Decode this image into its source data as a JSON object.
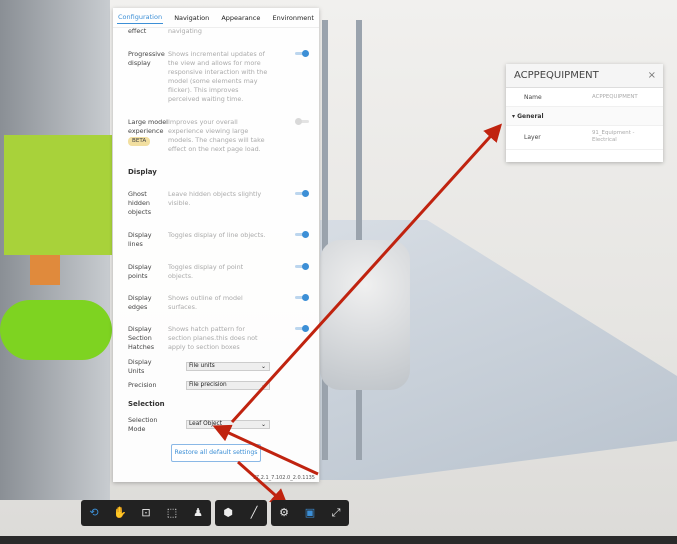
{
  "settings_panel": {
    "tabs": [
      "Configuration",
      "Navigation",
      "Appearance",
      "Environment"
    ],
    "active_tab": "Configuration",
    "partial_row": {
      "label": "effect",
      "description": "navigating"
    },
    "progressive": {
      "label": "Progressive display",
      "description": "Shows incremental updates of the view and allows for more responsive interaction with the model (some elements may flicker). This improves perceived waiting time.",
      "on": true
    },
    "large_model": {
      "label": "Large model experience",
      "badge": "BETA",
      "description": "Improves your overall experience viewing large models. The changes will take effect on the next page load.",
      "on": false
    },
    "display_heading": "Display",
    "ghost": {
      "label": "Ghost hidden objects",
      "description": "Leave hidden objects slightly visible.",
      "on": true
    },
    "lines": {
      "label": "Display lines",
      "description": "Toggles display of line objects.",
      "on": true
    },
    "points": {
      "label": "Display points",
      "description": "Toggles display of point objects.",
      "on": true
    },
    "edges": {
      "label": "Display edges",
      "description": "Shows outline of model surfaces.",
      "on": true
    },
    "hatches": {
      "label": "Display Section Hatches",
      "description": "Shows hatch pattern for section planes.this does not apply to section boxes",
      "on": true
    },
    "units": {
      "label": "Display Units",
      "value": "File units"
    },
    "precision": {
      "label": "Precision",
      "value": "File precision"
    },
    "selection_heading": "Selection",
    "selection_mode": {
      "label": "Selection Mode",
      "value": "Leaf Object"
    },
    "restore_label": "Restore all default settings",
    "version": "V7.2.1_7.102.0_2.0.1135"
  },
  "properties": {
    "title": "ACPPEQUIPMENT",
    "name_key": "Name",
    "name_value": "ACPPEQUIPMENT",
    "group": "General",
    "layer_key": "Layer",
    "layer_value": "91_Equipment - Electrical"
  },
  "toolbar": {
    "icons": [
      "orbit",
      "pan",
      "fit-to-view",
      "zoom-window",
      "first-person",
      "explode-model",
      "measure",
      "settings",
      "properties",
      "fullscreen"
    ]
  },
  "colors": {
    "accent": "#3c8fd6",
    "annotation": "#c0230f"
  }
}
